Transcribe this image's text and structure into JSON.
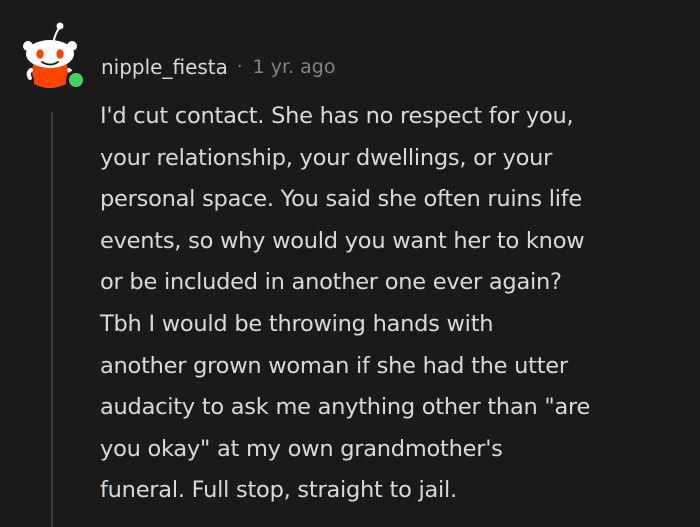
{
  "comment": {
    "username": "nipple_fiesta",
    "separator": "·",
    "timestamp": "1 yr. ago",
    "avatar_icon": "reddit-snoo-icon",
    "online_status_color": "#46d160",
    "body_lines": [
      "I'd cut contact. She has no respect for you,",
      "your relationship, your dwellings, or your",
      "personal space. You said she often ruins life",
      "events, so why would you want her to know",
      "or be included in another one ever again?",
      "Tbh I would be throwing hands with",
      "another grown woman if she had the utter",
      "audacity to ask me anything other than \"are",
      "you okay\" at my own grandmother's",
      "funeral. Full stop, straight to jail."
    ]
  },
  "colors": {
    "background": "#1a1a1b",
    "text": "#d7dadc",
    "meta_text": "#818384",
    "thread_line": "#3a3a3c",
    "avatar_accent": "#ff4500"
  }
}
